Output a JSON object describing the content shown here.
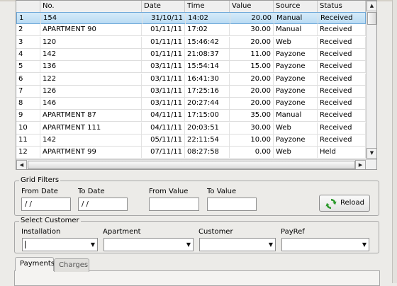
{
  "grid": {
    "columns": [
      "",
      "No.",
      "Date",
      "Time",
      "Value",
      "Source",
      "Status"
    ],
    "rows": [
      {
        "n": "1",
        "no": "154",
        "date": "31/10/11",
        "time": "14:02",
        "value": "20.00",
        "source": "Manual",
        "status": "Received"
      },
      {
        "n": "2",
        "no": "APARTMENT 90",
        "date": "01/11/11",
        "time": "17:02",
        "value": "30.00",
        "source": "Manual",
        "status": "Received"
      },
      {
        "n": "3",
        "no": "120",
        "date": "01/11/11",
        "time": "15:46:42",
        "value": "20.00",
        "source": "Web",
        "status": "Received"
      },
      {
        "n": "4",
        "no": "142",
        "date": "01/11/11",
        "time": "21:08:37",
        "value": "11.00",
        "source": "Payzone",
        "status": "Received"
      },
      {
        "n": "5",
        "no": "136",
        "date": "03/11/11",
        "time": "15:54:14",
        "value": "15.00",
        "source": "Payzone",
        "status": "Received"
      },
      {
        "n": "6",
        "no": "122",
        "date": "03/11/11",
        "time": "16:41:30",
        "value": "20.00",
        "source": "Payzone",
        "status": "Received"
      },
      {
        "n": "7",
        "no": "126",
        "date": "03/11/11",
        "time": "17:25:16",
        "value": "20.00",
        "source": "Payzone",
        "status": "Received"
      },
      {
        "n": "8",
        "no": "146",
        "date": "03/11/11",
        "time": "20:27:44",
        "value": "20.00",
        "source": "Payzone",
        "status": "Received"
      },
      {
        "n": "9",
        "no": "APARTMENT 87",
        "date": "04/11/11",
        "time": "17:15:00",
        "value": "35.00",
        "source": "Manual",
        "status": "Received"
      },
      {
        "n": "10",
        "no": "APARTMENT 111",
        "date": "04/11/11",
        "time": "20:03:51",
        "value": "30.00",
        "source": "Web",
        "status": "Received"
      },
      {
        "n": "11",
        "no": "142",
        "date": "05/11/11",
        "time": "22:11:54",
        "value": "10.00",
        "source": "Payzone",
        "status": "Received"
      },
      {
        "n": "12",
        "no": "APARTMENT 99",
        "date": "07/11/11",
        "time": "08:27:58",
        "value": "0.00",
        "source": "Web",
        "status": "Held"
      }
    ],
    "selected_row": 0
  },
  "filters": {
    "title": "Grid Filters",
    "from_date_label": "From Date",
    "from_date_value": " / /",
    "to_date_label": "To Date",
    "to_date_value": " / /",
    "from_value_label": "From Value",
    "from_value_value": "",
    "to_value_label": "To Value",
    "to_value_value": "",
    "reload_label": "Reload"
  },
  "customer": {
    "title": "Select Customer",
    "installation_label": "Installation",
    "apartment_label": "Apartment",
    "customer_label": "Customer",
    "payref_label": "PayRef"
  },
  "tabs": {
    "payments": "Payments",
    "charges": "Charges"
  },
  "colors": {
    "selection": "#b9dbf3",
    "reload_icon": "#2e9a2e"
  },
  "icons": {
    "reload": "reload-icon",
    "dropdown": "chevron-down-icon",
    "scroll_up": "triangle-up-icon",
    "scroll_down": "triangle-down-icon"
  }
}
